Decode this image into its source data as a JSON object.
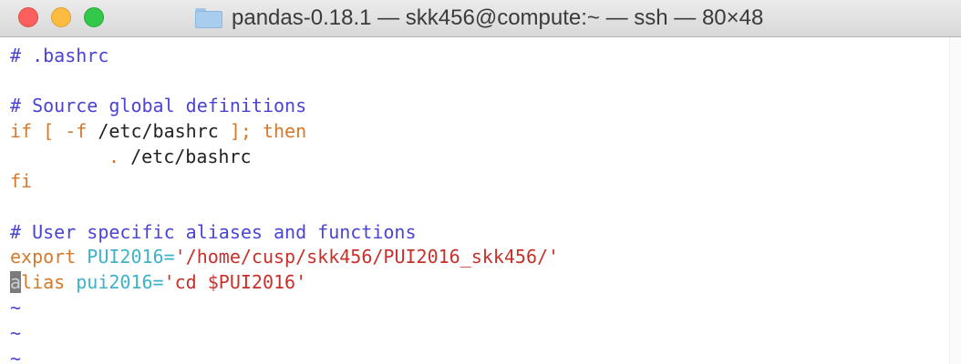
{
  "window": {
    "title": "pandas-0.18.1 — skk456@compute:~ — ssh — 80×48",
    "folder_icon": "folder-icon"
  },
  "colors": {
    "comment": "#4a44d6",
    "keyword": "#d4792a",
    "identifier": "#3fb2c8",
    "string": "#c8302a",
    "cursor": "#7b7b7b"
  },
  "editor": {
    "line1": "# .bashrc",
    "line3": "# Source global definitions",
    "line4": {
      "kw1": "if [ -f ",
      "path": "/etc/bashrc",
      "kw2": " ];",
      "kw3": " then"
    },
    "line5": {
      "dot": ".",
      "path": " /etc/bashrc"
    },
    "line6": "fi",
    "line8": "# User specific aliases and functions",
    "line9": {
      "kw": "export ",
      "var": "PUI2016=",
      "val": "'/home/cusp/skk456/PUI2016_skk456/'"
    },
    "line10": {
      "cursor_char": "a",
      "kw": "lias ",
      "var": "pui2016=",
      "val": "'cd $PUI2016'"
    },
    "tilde": "~"
  }
}
